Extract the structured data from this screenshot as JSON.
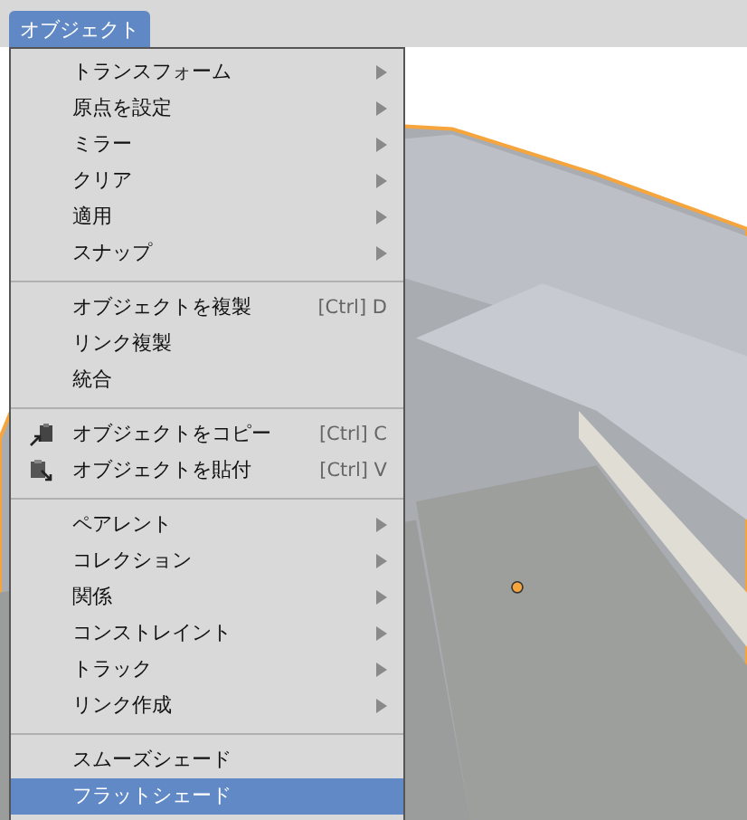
{
  "menu_bar": {
    "menu": {
      "label": "オブジェクト",
      "selected": true
    }
  },
  "viewport": {
    "origin_dot": true
  },
  "menu": {
    "items": [
      {
        "kind": "item",
        "label": "トランスフォーム",
        "submenu": true,
        "selected": false
      },
      {
        "kind": "item",
        "label": "原点を設定",
        "submenu": true,
        "selected": false
      },
      {
        "kind": "item",
        "label": "ミラー",
        "submenu": true,
        "selected": false
      },
      {
        "kind": "item",
        "label": "クリア",
        "submenu": true,
        "selected": false
      },
      {
        "kind": "item",
        "label": "適用",
        "submenu": true,
        "selected": false
      },
      {
        "kind": "item",
        "label": "スナップ",
        "submenu": true,
        "selected": false
      },
      {
        "kind": "separator"
      },
      {
        "kind": "item",
        "label": "オブジェクトを複製",
        "shortcut": "[Ctrl] D",
        "submenu": false,
        "selected": false
      },
      {
        "kind": "item",
        "label": "リンク複製",
        "submenu": false,
        "selected": false
      },
      {
        "kind": "item",
        "label": "統合",
        "submenu": false,
        "selected": false
      },
      {
        "kind": "separator"
      },
      {
        "kind": "item",
        "label": "オブジェクトをコピー",
        "shortcut": "[Ctrl] C",
        "submenu": false,
        "selected": false
      },
      {
        "kind": "item",
        "label": "オブジェクトを貼付",
        "shortcut": "[Ctrl] V",
        "submenu": false,
        "selected": false
      },
      {
        "kind": "separator"
      },
      {
        "kind": "item",
        "label": "ペアレント",
        "submenu": true,
        "selected": false
      },
      {
        "kind": "item",
        "label": "コレクション",
        "submenu": true,
        "selected": false
      },
      {
        "kind": "item",
        "label": "関係",
        "submenu": true,
        "selected": false
      },
      {
        "kind": "item",
        "label": "コンストレイント",
        "submenu": true,
        "selected": false
      },
      {
        "kind": "item",
        "label": "トラック",
        "submenu": true,
        "selected": false
      },
      {
        "kind": "item",
        "label": "リンク作成",
        "submenu": true,
        "selected": false
      },
      {
        "kind": "separator"
      },
      {
        "kind": "item",
        "label": "スムーズシェード",
        "submenu": false,
        "selected": false
      },
      {
        "kind": "item",
        "label": "フラットシェード",
        "submenu": false,
        "selected": true
      }
    ]
  }
}
